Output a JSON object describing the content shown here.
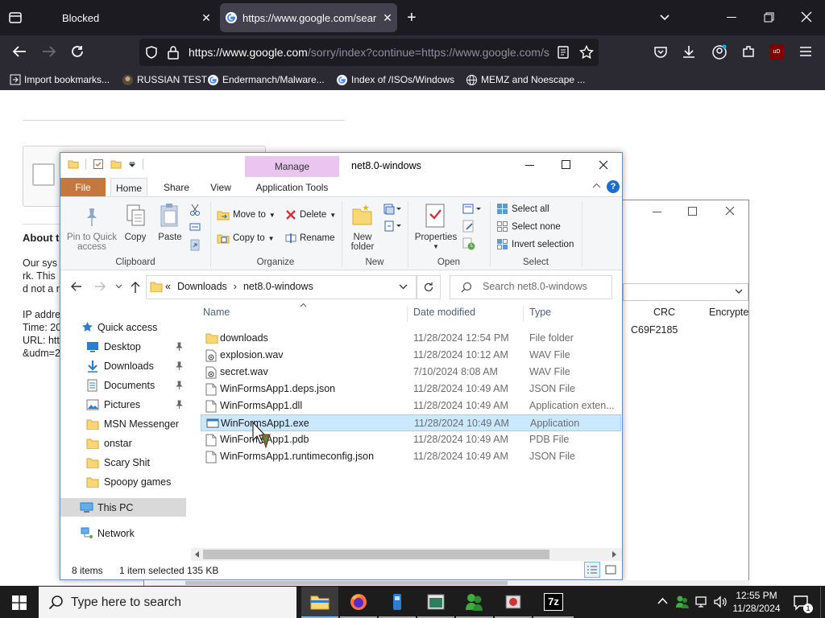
{
  "browser": {
    "tabs": [
      {
        "label": "Blocked"
      },
      {
        "label": "https://www.google.com/sear"
      }
    ],
    "url": {
      "domain": "https://www.google.com",
      "path": "/sorry/index?continue=https://www.google.com/s"
    },
    "bookmarks": [
      {
        "label": "Import bookmarks..."
      },
      {
        "label": "RUSSIAN TEST"
      },
      {
        "label": "Endermanch/Malware..."
      },
      {
        "label": "Index of /ISOs/Windows"
      },
      {
        "label": "MEMZ and Noescape ..."
      }
    ],
    "ublock_badge": "uD"
  },
  "webpage": {
    "about_heading": "About t",
    "lines": [
      "Our sys",
      "rk. This",
      "d not a r",
      "",
      "IP addre",
      "Time: 20",
      "URL: htt",
      "&udm=2"
    ]
  },
  "bg_window": {
    "col_crc": "CRC",
    "col_encrypted": "Encrypte",
    "crc_value": "C69F2185"
  },
  "explorer": {
    "title": "net8.0-windows",
    "contextual_tab": "Manage",
    "tabs": {
      "file": "File",
      "home": "Home",
      "share": "Share",
      "view": "View",
      "app_tools": "Application Tools"
    },
    "ribbon": {
      "clipboard": {
        "pin": "Pin to Quick\naccess",
        "copy": "Copy",
        "paste": "Paste",
        "group": "Clipboard"
      },
      "organize": {
        "move_to": "Move to",
        "copy_to": "Copy to",
        "delete": "Delete",
        "rename": "Rename",
        "group": "Organize"
      },
      "new": {
        "new_folder": "New\nfolder",
        "group": "New"
      },
      "open": {
        "properties": "Properties",
        "group": "Open"
      },
      "select": {
        "select_all": "Select all",
        "select_none": "Select none",
        "invert": "Invert selection",
        "group": "Select"
      }
    },
    "breadcrumb": {
      "prefix": "«",
      "part1": "Downloads",
      "sep": "›",
      "part2": "net8.0-windows"
    },
    "search_placeholder": "Search net8.0-windows",
    "nav": {
      "quick_access": "Quick access",
      "pinned": [
        {
          "label": "Desktop",
          "icon": "desktop-icon"
        },
        {
          "label": "Downloads",
          "icon": "download-arrow-icon"
        },
        {
          "label": "Documents",
          "icon": "documents-icon"
        },
        {
          "label": "Pictures",
          "icon": "pictures-icon"
        }
      ],
      "folders": [
        "MSN Messenger",
        "onstar",
        "Scary Shit",
        "Spoopy games"
      ],
      "this_pc": "This PC",
      "network": "Network"
    },
    "columns": {
      "name": "Name",
      "date": "Date modified",
      "type": "Type"
    },
    "files": [
      {
        "name": "downloads",
        "date": "11/28/2024 12:54 PM",
        "type": "File folder",
        "icon": "folder"
      },
      {
        "name": "explosion.wav",
        "date": "11/28/2024 10:12 AM",
        "type": "WAV File",
        "icon": "audio"
      },
      {
        "name": "secret.wav",
        "date": "7/10/2024 8:08 AM",
        "type": "WAV File",
        "icon": "audio"
      },
      {
        "name": "WinFormsApp1.deps.json",
        "date": "11/28/2024 10:49 AM",
        "type": "JSON File",
        "icon": "file"
      },
      {
        "name": "WinFormsApp1.dll",
        "date": "11/28/2024 10:49 AM",
        "type": "Application exten...",
        "icon": "file"
      },
      {
        "name": "WinFormsApp1.exe",
        "date": "11/28/2024 10:49 AM",
        "type": "Application",
        "icon": "exe",
        "selected": true
      },
      {
        "name": "WinFormsApp1.pdb",
        "date": "11/28/2024 10:49 AM",
        "type": "PDB File",
        "icon": "file"
      },
      {
        "name": "WinFormsApp1.runtimeconfig.json",
        "date": "11/28/2024 10:49 AM",
        "type": "JSON File",
        "icon": "file"
      }
    ],
    "status": {
      "items": "8 items",
      "selected": "1 item selected",
      "size": "135 KB"
    }
  },
  "taskbar": {
    "search_placeholder": "Type here to search",
    "time": "12:55 PM",
    "date": "11/28/2024",
    "notification_count": "1",
    "apps": [
      "file-explorer-icon",
      "firefox-icon",
      "app-icon",
      "app-icon",
      "msn-icon",
      "app-icon",
      "7zip-icon"
    ]
  },
  "colors": {
    "accent": "#0078d7",
    "file_tab": "#c5783e",
    "manage_tab": "#e9c5f0",
    "selection": "#cce8ff",
    "browser_bg": "#1c1b22"
  }
}
